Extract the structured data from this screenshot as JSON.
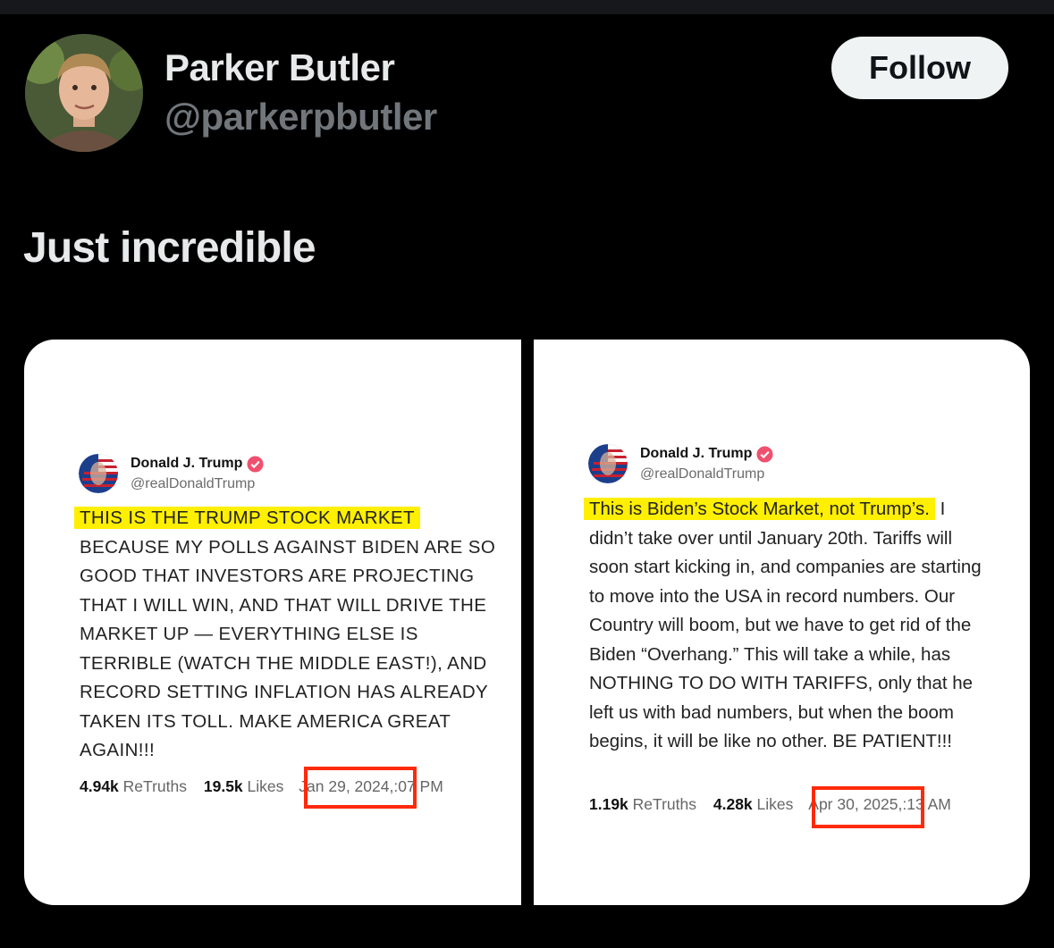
{
  "author": {
    "name": "Parker Butler",
    "handle": "@parkerpbutler"
  },
  "follow_label": "Follow",
  "post_text": "Just incredible",
  "media": [
    {
      "name": "Donald J. Trump",
      "handle": "@realDonaldTrump",
      "highlight": "THIS IS THE TRUMP STOCK MARKET",
      "body": "BECAUSE MY POLLS AGAINST BIDEN ARE SO GOOD THAT INVESTORS ARE PROJECTING THAT I WILL WIN, AND THAT WILL DRIVE THE MARKET UP — EVERYTHING ELSE IS TERRIBLE (WATCH THE MIDDLE EAST!), AND RECORD SETTING INFLATION HAS ALREADY TAKEN ITS TOLL. MAKE AMERICA GREAT AGAIN!!!",
      "retruths_count": "4.94k",
      "retruths_label": "ReTruths",
      "likes_count": "19.5k",
      "likes_label": "Likes",
      "date": "Jan 29, 2024,",
      "time": ":07 PM"
    },
    {
      "name": "Donald J. Trump",
      "handle": "@realDonaldTrump",
      "highlight": "This is Biden’s Stock Market, not Trump’s.",
      "body": " I didn’t take over until January 20th. Tariffs will soon start kicking in, and companies are starting to move into the USA in record numbers. Our Country will boom, but we have to get rid of the Biden “Overhang.” This will take a while, has NOTHING TO DO WITH TARIFFS, only that he left us with bad numbers, but when the boom begins, it will be like no other. BE PATIENT!!!",
      "retruths_count": "1.19k",
      "retruths_label": "ReTruths",
      "likes_count": "4.28k",
      "likes_label": "Likes",
      "date": "Apr 30, 2025,",
      "time": ":13 AM"
    }
  ],
  "colors": {
    "background": "#000000",
    "follow_button_bg": "#eff3f4",
    "handle_gray": "#71767b",
    "highlight_yellow": "#ffef00",
    "annotation_red": "#ff2a0a",
    "verified_pink": "#f0506e"
  }
}
